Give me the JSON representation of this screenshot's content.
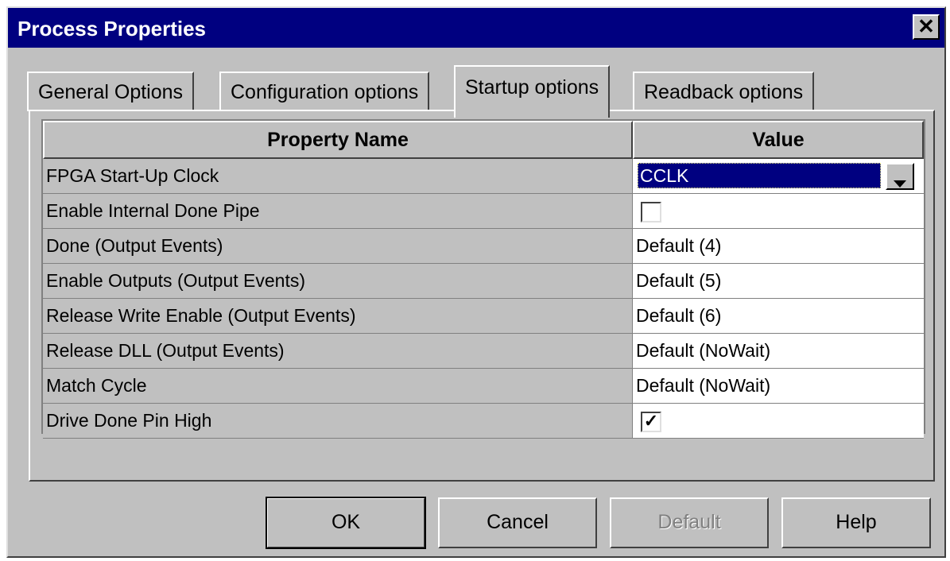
{
  "window": {
    "title": "Process Properties",
    "close_glyph": "✕"
  },
  "tabs": [
    {
      "label": "General Options",
      "active": false
    },
    {
      "label": "Configuration options",
      "active": false
    },
    {
      "label": "Startup options",
      "active": true
    },
    {
      "label": "Readback options",
      "active": false
    }
  ],
  "grid": {
    "headers": {
      "name": "Property Name",
      "value": "Value"
    },
    "rows": [
      {
        "name": "FPGA Start-Up Clock",
        "value": "CCLK",
        "kind": "combo"
      },
      {
        "name": "Enable Internal Done Pipe",
        "value": "",
        "kind": "checkbox",
        "checked": false
      },
      {
        "name": "Done (Output Events)",
        "value": "Default (4)",
        "kind": "text"
      },
      {
        "name": "Enable Outputs (Output Events)",
        "value": "Default (5)",
        "kind": "text"
      },
      {
        "name": "Release Write Enable (Output Events)",
        "value": "Default (6)",
        "kind": "text"
      },
      {
        "name": "Release DLL (Output Events)",
        "value": "Default (NoWait)",
        "kind": "text"
      },
      {
        "name": "Match Cycle",
        "value": "Default (NoWait)",
        "kind": "text"
      },
      {
        "name": "Drive Done Pin High",
        "value": "",
        "kind": "checkbox",
        "checked": true
      }
    ],
    "check_glyph": "✓"
  },
  "buttons": {
    "ok": "OK",
    "cancel": "Cancel",
    "default": "Default",
    "help": "Help"
  },
  "colors": {
    "title_bar": "#000080",
    "face": "#c0c0c0",
    "selection": "#000080"
  },
  "icons": {
    "close": "close-icon",
    "dropdown": "chevron-down-icon",
    "check": "checkmark-icon"
  }
}
